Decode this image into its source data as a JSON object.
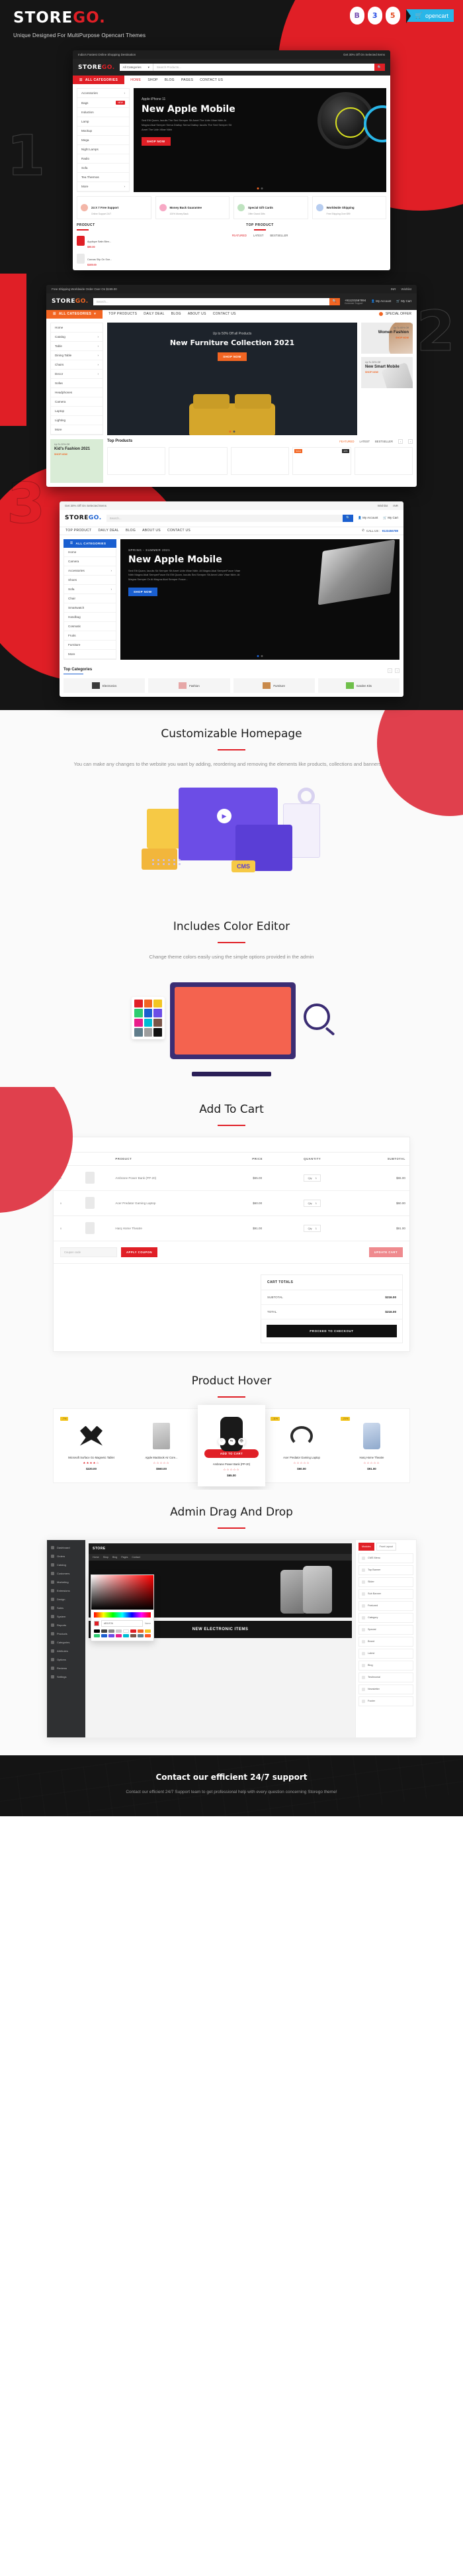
{
  "hero": {
    "brand_main": "STORE",
    "brand_accent": "GO.",
    "tagline": "Unique Designed For MultiPurpose Opencart Themes",
    "badges": [
      {
        "name": "bootstrap-badge",
        "label": "B"
      },
      {
        "name": "css3-badge",
        "label": "3"
      },
      {
        "name": "html5-badge",
        "label": "5"
      }
    ],
    "opencart_label": "opencart",
    "opencart_icon": "cart-icon"
  },
  "colors": {
    "red": "#e01f26",
    "orange": "#f26522",
    "blue": "#1a5fd0",
    "dark": "#151515",
    "light_bg": "#fafafa"
  },
  "showcase": {
    "numbers": [
      "1",
      "2",
      "3"
    ],
    "shot1": {
      "topbar_left": "India's Fastest Online Shopping Destination",
      "topbar_right": "Get 30% Off On Selected Items",
      "logo_main": "STORE",
      "logo_accent": "GO.",
      "search_select": "All Categories",
      "search_placeholder": "Search Products...",
      "search_icon": "search-icon",
      "all_categories": "ALL CATEGORIES",
      "nav": [
        "HOME",
        "SHOP",
        "BLOG",
        "PAGES",
        "CONTACT US"
      ],
      "categories": [
        "Accessories",
        "Bags",
        "Induction",
        "Lamp",
        "Mockup",
        "Mega",
        "Night Lamps",
        "Radio",
        "Sofa",
        "Tea Thermos",
        "More"
      ],
      "cat_badge": "NEW",
      "banner_sub": "Apple iPhone 11",
      "banner_title": "New Apple Mobile",
      "banner_desc": "Sed Elit Quam, Iaculis The Sed Semper Sit Amet The Udin Vitae Nibh At Magna Akat Semper Sema Diatiup Sema Diatiup Iaculis The Sed Semper Sit Amet The Udin Vitae Nibh",
      "banner_btn": "SHOP NOW",
      "features": [
        {
          "title": "24 X 7 Free Support",
          "sub": "Online Support 24/7"
        },
        {
          "title": "Money Back Guarantee",
          "sub": "100% Money Back"
        },
        {
          "title": "Special Gift Cards",
          "sub": "Offer Grand Gifts"
        },
        {
          "title": "Worldwide Shipping",
          "sub": "Free Shipping Over $99"
        }
      ],
      "product_label": "PRODUCT",
      "products": [
        {
          "name": "Applique Satin Blen...",
          "old": "$100.00",
          "price": "$90.00"
        },
        {
          "name": "Canvas Slip On Sne...",
          "old": "$115.00",
          "price": "$105.00"
        }
      ],
      "top_product_label": "TOP PRODUCT",
      "top_tabs": [
        "FEATURED",
        "LATEST",
        "BESTSELLER"
      ]
    },
    "shot2": {
      "topbar_left": "Free Shipping Worldwide Order Over On $199.00",
      "topbar_right": [
        "INR",
        "Wishlist"
      ],
      "logo_main": "STORE",
      "logo_accent": "GO.",
      "search_placeholder": "Search...",
      "phone": "+911231567894",
      "phone_sub": "Customer Support",
      "account": "My Account",
      "cart": "My Cart",
      "all_categories": "ALL CATEGORIES",
      "nav": [
        "TOP PRODUCTS",
        "DAILY DEAL",
        "BLOG",
        "ABOUT US",
        "CONTACT US"
      ],
      "special_offer": "SPECIAL OFFER",
      "categories": [
        "Home",
        "Catalog",
        "Table",
        "Dining Table",
        "Chairs",
        "Decor",
        "Sofas",
        "Headphones",
        "Camera",
        "Laptop",
        "Lighting",
        "More"
      ],
      "banner_sub": "Up to 50% Off all Products",
      "banner_title": "New Furniture Collection 2021",
      "banner_btn": "SHOP NOW",
      "side_banners": [
        {
          "off": "Up To 60% Off",
          "title": "Women Fashion",
          "link": "SHOP NOW"
        },
        {
          "off": "Up To 30% Off",
          "title": "New Smart Mobile",
          "link": "SHOP NOW"
        }
      ],
      "kid_banner": {
        "off": "Up To 20% Off",
        "title": "Kid's Fashion 2021",
        "link": "SHOP NOW"
      },
      "top_products": "Top Products",
      "tabs": [
        "FEATURED",
        "LATEST",
        "BESTSELLER"
      ],
      "badges": [
        "SALE",
        "-20%"
      ]
    },
    "shot3": {
      "topbar_left": "Get 30% Off On Selected Items",
      "topbar_right": [
        "Wishlist",
        "INR"
      ],
      "logo_main": "STORE",
      "logo_accent": "GO.",
      "search_placeholder": "Search...",
      "account": "My Account",
      "cart": "My Cart",
      "nav": [
        "TOP PRODUCT",
        "DAILY DEAL",
        "BLOG",
        "ABOUT US",
        "CONTACT US"
      ],
      "call_us": "CALL US :",
      "call_number": "9123456789",
      "all_categories": "ALL CATEGORIES",
      "categories": [
        "Home",
        "Camera",
        "Accessories",
        "Shoes",
        "Sofa",
        "Chair",
        "Smartwatch",
        "Handbag",
        "Cosmatic",
        "Fruits",
        "Furniture",
        "More"
      ],
      "banner_sub": "SPRING - SUMMER 2021",
      "banner_title": "New Apple Mobile",
      "banner_desc": "Sed Elit Quam, Iaculis Sd Semper Sit Amet Udin Vitae Nibh. At Magna Akal SemperFusce Vitae Nibh Magna Akal SemperFusce Ed Elit Quam, Iaculis Sed Semper Sit Amet Udin Vitae Nibh. At Magna Semper Or At Magna Akal Semper Fusce...",
      "banner_btn": "SHOP NOW",
      "top_categories": "Top Categories",
      "cats": [
        "Electronics",
        "Fashion",
        "Furniture",
        "Garden Kits"
      ]
    }
  },
  "sections": [
    {
      "id": "customizable-homepage",
      "title": "Customizable Homepage",
      "desc": "You can make any changes to the website you want by adding, reordering and removing the elements like products, collections and banners etc",
      "cms_label": "CMS",
      "play_icon": "play-icon"
    },
    {
      "id": "color-editor",
      "title": "Includes Color Editor",
      "desc": "Change theme colors easily using the simple options provided in the admin"
    },
    {
      "id": "add-to-cart",
      "title": "Add To Cart",
      "desc": ""
    },
    {
      "id": "product-hover",
      "title": "Product Hover",
      "desc": ""
    },
    {
      "id": "admin-drag-drop",
      "title": "Admin Drag And Drop",
      "desc": ""
    }
  ],
  "cart": {
    "label": "CART",
    "columns": [
      "",
      "",
      "PRODUCT",
      "PRICE",
      "QUANTITY",
      "SUBTOTAL"
    ],
    "rows": [
      {
        "remove": "x",
        "product": "Ambrane Power Bank (PP-20)",
        "price": "$65.00",
        "qty_label": "Qty",
        "qty": "1",
        "subtotal": "$65.00"
      },
      {
        "remove": "x",
        "product": "Acer Predator Gaming Laptop",
        "price": "$60.00",
        "qty_label": "Qty",
        "qty": "1",
        "subtotal": "$60.00"
      },
      {
        "remove": "x",
        "product": "Harq Home Theatre",
        "price": "$91.00",
        "qty_label": "Qty",
        "qty": "1",
        "subtotal": "$91.00"
      }
    ],
    "coupon_placeholder": "Coupon code",
    "apply_coupon": "APPLY COUPON",
    "update_cart": "UPDATE CART",
    "totals_title": "CART TOTALS",
    "subtotal_label": "SUBTOTAL",
    "subtotal_value": "$216.00",
    "total_label": "TOTAL",
    "total_value": "$216.00",
    "checkout": "PROCEED TO CHECKOUT"
  },
  "product_hover": {
    "products": [
      {
        "discount": "-7%",
        "name": "Microsoft Surface Go Magnetic Tablet",
        "stars": "★★★★☆",
        "price": "$220.00",
        "hovered": false
      },
      {
        "discount": "",
        "name": "Apple MacBook Air Core...",
        "stars": "☆☆☆☆☆",
        "price": "$560.00",
        "hovered": false
      },
      {
        "discount": "",
        "name": "Ambrane Power Bank (PP-20)",
        "stars": "☆☆☆☆☆",
        "price": "$65.00",
        "hovered": true
      },
      {
        "discount": "-11%",
        "name": "Acer Predator Gaming Laptop",
        "stars": "☆☆☆☆☆",
        "price": "$60.00",
        "hovered": false
      },
      {
        "discount": "-21%",
        "name": "Harq Home Theatre",
        "stars": "☆☆☆☆☆",
        "price": "$91.00",
        "hovered": false
      }
    ],
    "add_to_cart": "ADD TO CART",
    "hover_icons": [
      "heart-icon",
      "compare-icon",
      "eye-icon"
    ]
  },
  "admin": {
    "sidebar": [
      "Dashboard",
      "Orders",
      "Catalog",
      "Customers",
      "Marketing",
      "Extensions",
      "Design",
      "Sales",
      "System",
      "Reports",
      "Products",
      "Categories",
      "Attributes",
      "Options",
      "Reviews",
      "Settings"
    ],
    "store_title": "STORE",
    "store_nav": [
      "Home",
      "Shop",
      "Blog",
      "Pages",
      "Contact"
    ],
    "color_picker": {
      "hex_value": "#E01F26",
      "name_label": "Name",
      "swatches": [
        "#000000",
        "#444444",
        "#888888",
        "#cccccc",
        "#ffffff",
        "#e01f26",
        "#f26522",
        "#f3c623",
        "#2ecc71",
        "#1a5fd0",
        "#6c4de6",
        "#e91e8c",
        "#00bcd4",
        "#795548",
        "#607d8b",
        "#ff5722"
      ]
    },
    "banner_text": "NEW ELECTRONIC ITEMS",
    "right_tabs": [
      "Modules",
      "Front Layout"
    ],
    "right_items": [
      "CMS Menu",
      "Top Banner",
      "Slider",
      "Sub Banner",
      "Featured",
      "Category",
      "Special",
      "Brand",
      "Latest",
      "Blog",
      "Testimonial",
      "Newsletter",
      "Footer"
    ]
  },
  "footer": {
    "title": "Contact our efficient 24/7 support",
    "desc": "Contact our efficient 24/7 Support team to get professional help with every question concerning Storego theme!"
  }
}
